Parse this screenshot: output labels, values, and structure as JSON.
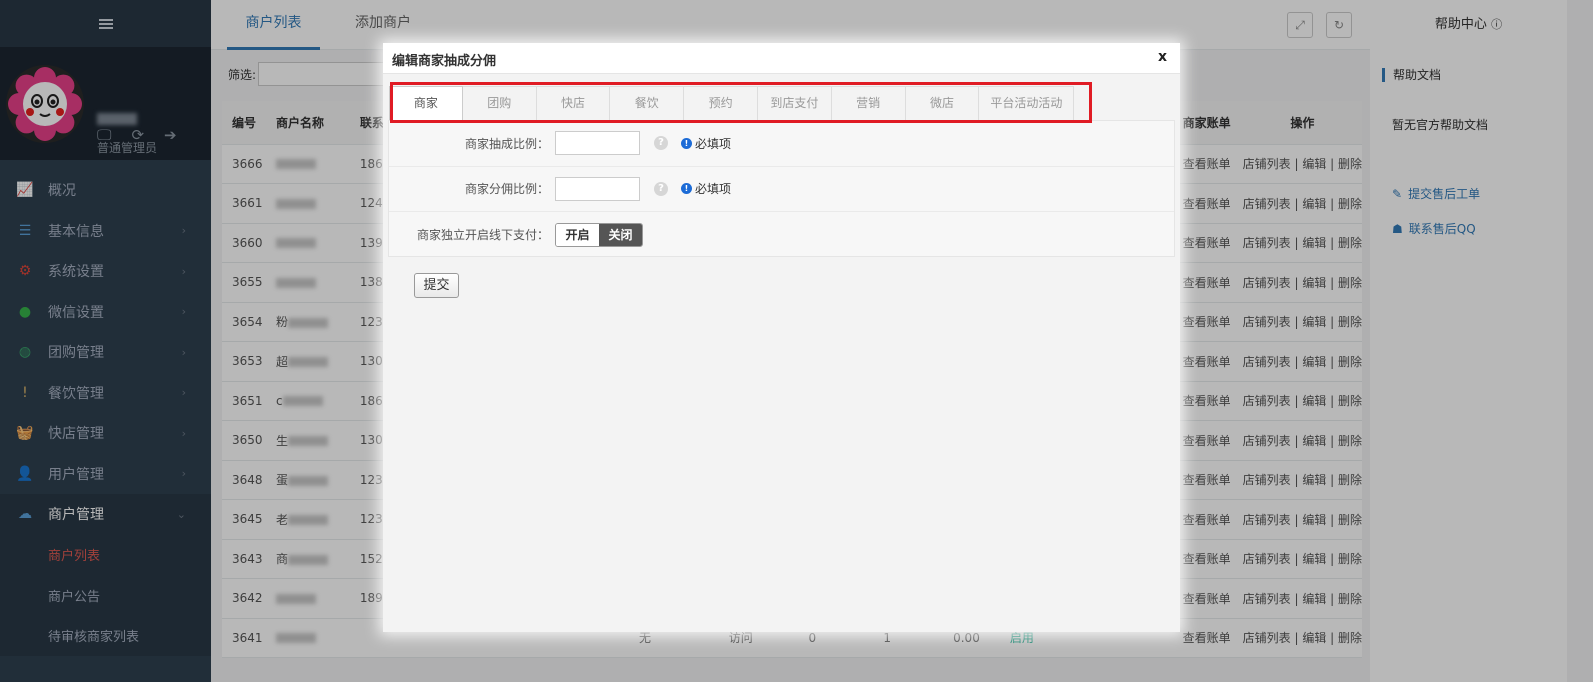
{
  "sidebar": {
    "role": "普通管理员",
    "menu": [
      {
        "icon": "chart-line-icon",
        "label": "概况",
        "chev": ""
      },
      {
        "icon": "list-icon",
        "label": "基本信息",
        "chev": "›"
      },
      {
        "icon": "gear-icon",
        "label": "系统设置",
        "chev": "›"
      },
      {
        "icon": "wechat-icon",
        "label": "微信设置",
        "chev": "›"
      },
      {
        "icon": "globe-icon",
        "label": "团购管理",
        "chev": "›"
      },
      {
        "icon": "pin-icon",
        "label": "餐饮管理",
        "chev": "›"
      },
      {
        "icon": "basket-icon",
        "label": "快店管理",
        "chev": "›"
      },
      {
        "icon": "user-icon",
        "label": "用户管理",
        "chev": "›"
      },
      {
        "icon": "cloud-icon",
        "label": "商户管理",
        "chev": "⌄"
      }
    ],
    "submenu": [
      "商户列表",
      "商户公告",
      "待审核商家列表"
    ]
  },
  "topbar": {
    "tabs": [
      "商户列表",
      "添加商户"
    ]
  },
  "filter": {
    "label": "筛选:"
  },
  "table": {
    "headers": [
      "编号",
      "商户名称",
      "联系",
      "",
      "",
      "",
      "",
      "",
      "商家账单",
      "操作"
    ],
    "rows": [
      {
        "id": "3666",
        "name": "",
        "phone": "186",
        "bill": "查看账单",
        "ops": "店铺列表 | 编辑 | 删除"
      },
      {
        "id": "3661",
        "name": "",
        "phone": "124",
        "bill": "查看账单",
        "ops": "店铺列表 | 编辑 | 删除"
      },
      {
        "id": "3660",
        "name": "",
        "phone": "139",
        "bill": "查看账单",
        "ops": "店铺列表 | 编辑 | 删除"
      },
      {
        "id": "3655",
        "name": "",
        "phone": "138",
        "bill": "查看账单",
        "ops": "店铺列表 | 编辑 | 删除"
      },
      {
        "id": "3654",
        "name": "粉",
        "phone": "123",
        "bill": "查看账单",
        "ops": "店铺列表 | 编辑 | 删除"
      },
      {
        "id": "3653",
        "name": "超",
        "phone": "130",
        "bill": "查看账单",
        "ops": "店铺列表 | 编辑 | 删除"
      },
      {
        "id": "3651",
        "name": "c",
        "phone": "186",
        "bill": "查看账单",
        "ops": "店铺列表 | 编辑 | 删除"
      },
      {
        "id": "3650",
        "name": "生",
        "phone": "130",
        "bill": "查看账单",
        "ops": "店铺列表 | 编辑 | 删除"
      },
      {
        "id": "3648",
        "name": "蛋",
        "phone": "123",
        "bill": "查看账单",
        "ops": "店铺列表 | 编辑 | 删除"
      },
      {
        "id": "3645",
        "name": "老",
        "phone": "123",
        "bill": "查看账单",
        "ops": "店铺列表 | 编辑 | 删除"
      },
      {
        "id": "3643",
        "name": "商",
        "phone": "152",
        "bill": "查看账单",
        "ops": "店铺列表 | 编辑 | 删除"
      },
      {
        "id": "3642",
        "name": "",
        "phone": "189",
        "bill": "查看账单",
        "ops": "店铺列表 | 编辑 | 删除"
      },
      {
        "id": "3641",
        "name": "",
        "phone": "",
        "col4": "无",
        "col5": "访问",
        "col6": "0",
        "col7": "1",
        "col8": "0.00",
        "status": "启用",
        "bill": "查看账单",
        "ops": "店铺列表 | 编辑 | 删除"
      }
    ]
  },
  "rightpanel": {
    "title": "帮助中心",
    "docs_title": "帮助文档",
    "docs_none": "暂无官方帮助文档",
    "link1": "提交售后工单",
    "link2": "联系售后QQ"
  },
  "modal": {
    "title": "编辑商家抽成分佣",
    "close": "x",
    "tabs": [
      "商家",
      "团购",
      "快店",
      "餐饮",
      "预约",
      "到店支付",
      "营销",
      "微店",
      "平台活动活动"
    ],
    "fields": {
      "commission_label": "商家抽成比例：",
      "rebate_label": "商家分佣比例：",
      "offline_label": "商家独立开启线下支付：",
      "required_text": "必填项",
      "help": "?",
      "req": "!",
      "toggle_on": "开启",
      "toggle_off": "关闭"
    },
    "submit": "提交"
  }
}
